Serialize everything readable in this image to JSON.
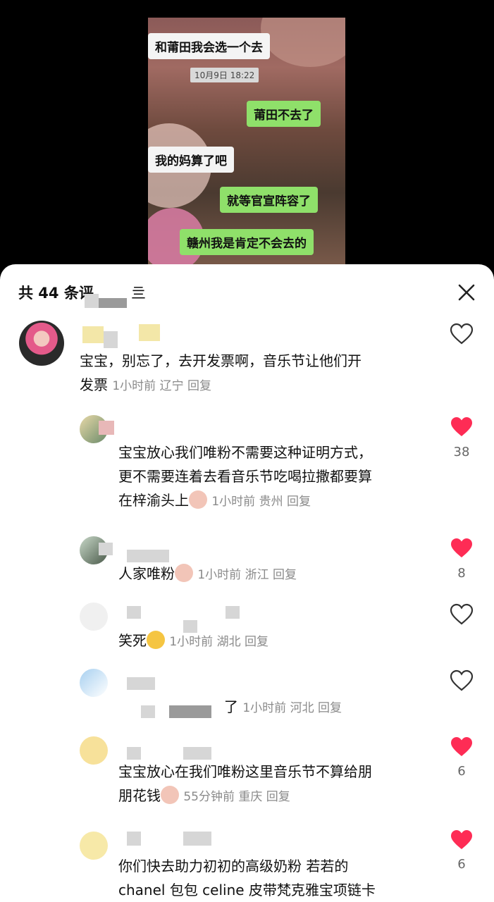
{
  "video": {
    "chat_messages": [
      {
        "side": "left",
        "text": "和莆田我会选一个去"
      },
      {
        "side": "time",
        "text": "10月9日 18:22"
      },
      {
        "side": "right",
        "text": "莆田不去了"
      },
      {
        "side": "left",
        "text": "我的妈算了吧"
      },
      {
        "side": "right",
        "text": "就等官宣阵容了"
      },
      {
        "side": "right",
        "text": "赣州我是肯定不会去的"
      }
    ]
  },
  "sheet": {
    "title": "共 44 条评",
    "title_suffix": "亖",
    "close_icon": "close-icon"
  },
  "comments": [
    {
      "text_line1": "宝宝，别忘了，去开发票啊，音乐节让他们开",
      "text_line2": "发票",
      "meta": "1小时前 辽宁 回复",
      "liked": false,
      "likes": ""
    },
    {
      "text_line1": "宝宝放心我们唯粉不需要这种证明方式，",
      "text_line2": "更不需要连着去看音乐节吃喝拉撒都要算",
      "text_line3": "在梓渝头上",
      "meta": "1小时前 贵州 回复",
      "liked": true,
      "likes": "38"
    },
    {
      "text_line1": "人家唯粉",
      "meta": "1小时前 浙江 回复",
      "liked": true,
      "likes": "8"
    },
    {
      "text_line1": "笑死",
      "meta": "1小时前 湖北 回复",
      "liked": false,
      "likes": ""
    },
    {
      "text_line1": "了",
      "meta": "1小时前 河北 回复",
      "liked": false,
      "likes": ""
    },
    {
      "text_line1": "宝宝放心在我们唯粉这里音乐节不算给朋",
      "text_line2": "朋花钱",
      "meta": "55分钟前 重庆 回复",
      "liked": true,
      "likes": "6"
    },
    {
      "text_line1": "你们快去助力初初的高级奶粉 若若的",
      "text_line2": "chanel 包包 celine 皮带梵克雅宝项链卡",
      "liked": true,
      "likes": "6"
    }
  ],
  "colors": {
    "like_red": "#fe2c55",
    "meta_gray": "#8a8a8a",
    "bubble_green": "#8fe06a"
  }
}
